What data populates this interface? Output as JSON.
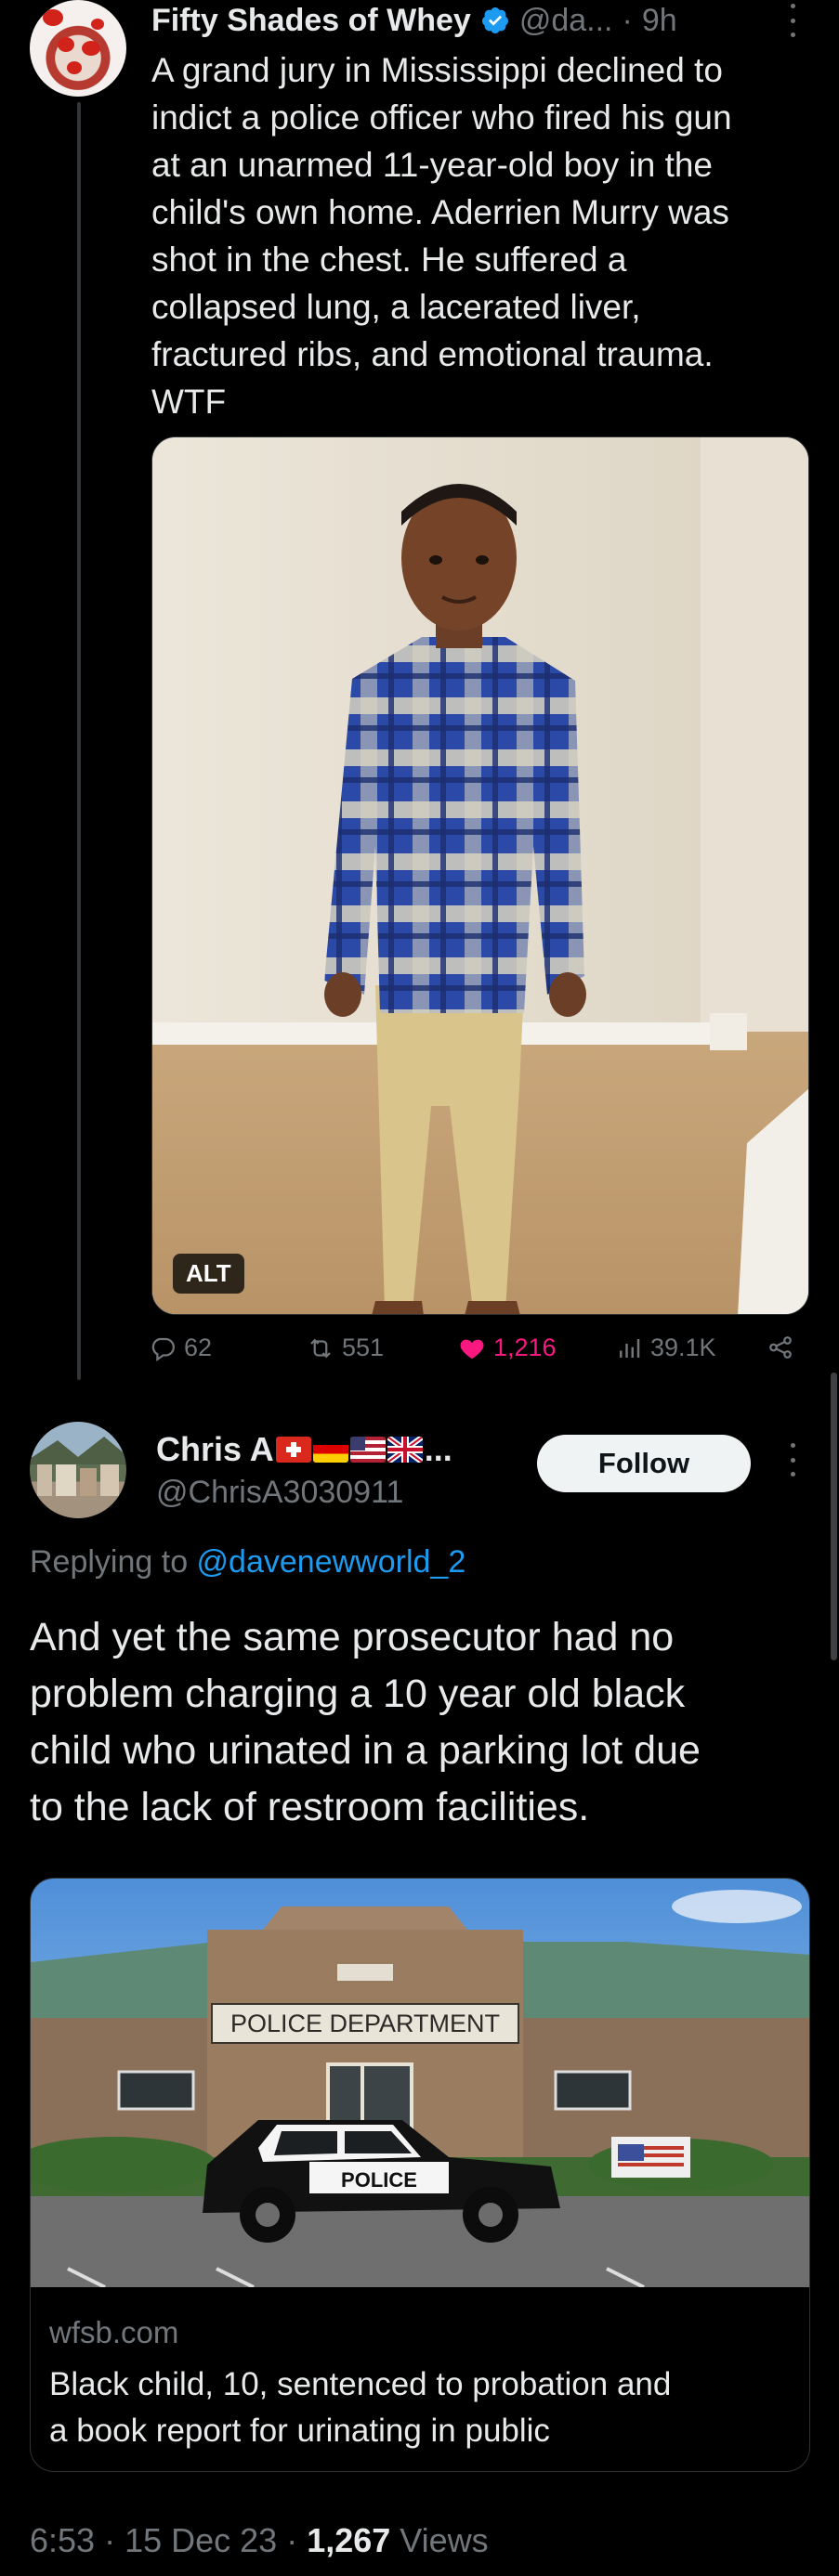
{
  "parent_tweet": {
    "author_name": "Fifty Shades of Whey",
    "handle_truncated": "@da...",
    "time_separator": "·",
    "age": "9h",
    "text": "A grand jury in Mississippi declined to\nindict a police officer who fired his gun\nat an unarmed 11-year-old boy in the\nchild's own home. Aderrien Murry was\nshot in the chest. He suffered a\ncollapsed lung, a lacerated liver,\nfractured ribs, and emotional trauma.\nWTF",
    "media": {
      "alt_badge": "ALT"
    },
    "stats": {
      "replies": "62",
      "reposts": "551",
      "likes": "1,216",
      "views": "39.1K"
    },
    "colors": {
      "like": "#f91880",
      "verified": "#1d9bf0"
    }
  },
  "reply_tweet": {
    "author_name": "Chris A",
    "name_suffix": "...",
    "flags": [
      "flag-switzerland",
      "flag-germany",
      "flag-usa",
      "flag-uk"
    ],
    "handle": "@ChrisA3030911",
    "follow_label": "Follow",
    "replying_prefix": "Replying to ",
    "replying_to": "@davenewworld_2",
    "text": "And yet the same prosecutor had no\nproblem charging a 10 year old black\nchild who urinated in a parking lot due\nto the lack of restroom facilities.",
    "link_card": {
      "image_sign": "POLICE DEPARTMENT",
      "vehicle_text": "POLICE",
      "domain": "wfsb.com",
      "title": "Black child, 10, sentenced to probation and\na book report for urinating in public"
    },
    "meta": {
      "time": "6:53",
      "date": "15 Dec 23",
      "separator": " · ",
      "views_count": "1,267",
      "views_label": " Views"
    }
  }
}
